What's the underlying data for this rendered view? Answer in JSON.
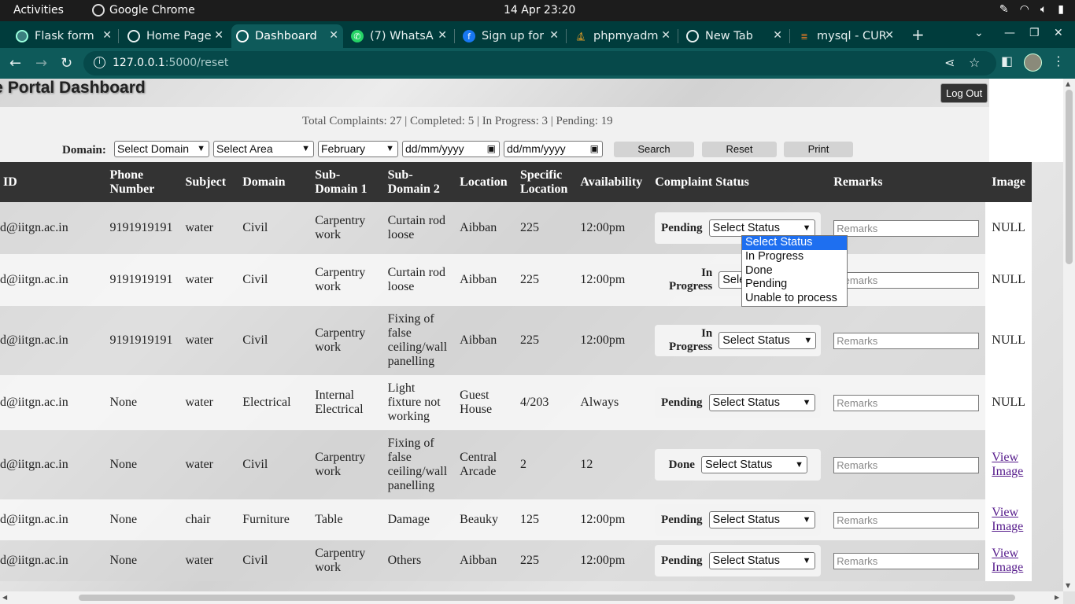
{
  "os": {
    "activities": "Activities",
    "app_name": "Google Chrome",
    "clock": "14 Apr  23:20"
  },
  "browser": {
    "tabs": [
      {
        "title": "Flask form",
        "icon": "flask-icon"
      },
      {
        "title": "Home Page",
        "icon": "globe-icon"
      },
      {
        "title": "Dashboard",
        "icon": "globe-icon",
        "active": true
      },
      {
        "title": "(7) WhatsA",
        "icon": "whatsapp-icon"
      },
      {
        "title": "Sign up for",
        "icon": "facebook-icon"
      },
      {
        "title": "phpmyadm",
        "icon": "phpmyadmin-icon"
      },
      {
        "title": "New Tab",
        "icon": "chrome-icon"
      },
      {
        "title": "mysql - CUR",
        "icon": "stackoverflow-icon"
      }
    ],
    "url_host": "127.0.0.1",
    "url_path": ":5000/reset"
  },
  "page": {
    "title": "ence Portal Dashboard",
    "logout_label": "Log Out",
    "stats": "Total Complaints: 27 | Completed: 5 | In Progress: 3 | Pending: 19"
  },
  "filters": {
    "domain_label": "Domain:",
    "domain_value": "Select Domain",
    "area_value": "Select Area",
    "month_value": "February",
    "date_from_placeholder": "dd/mm/yyyy",
    "date_to_placeholder": "dd/mm/yyyy",
    "search_label": "Search",
    "reset_label": "Reset",
    "print_label": "Print"
  },
  "table": {
    "headers": {
      "id": "ID",
      "phone": "Phone Number",
      "subject": "Subject",
      "domain": "Domain",
      "sub1": "Sub-Domain 1",
      "sub2": "Sub-Domain 2",
      "location": "Location",
      "specific": "Specific Location",
      "availability": "Availability",
      "status": "Complaint Status",
      "remarks": "Remarks",
      "image": "Image"
    },
    "status_select_value": "Select Status",
    "remarks_placeholder": "Remarks",
    "rows": [
      {
        "id": "d@iitgn.ac.in",
        "phone": "9191919191",
        "subject": "water",
        "domain": "Civil",
        "sub1": "Carpentry work",
        "sub2": "Curtain rod loose",
        "location": "Aibban",
        "specific": "225",
        "availability": "12:00pm",
        "status": "Pending",
        "image": "NULL"
      },
      {
        "id": "d@iitgn.ac.in",
        "phone": "9191919191",
        "subject": "water",
        "domain": "Civil",
        "sub1": "Carpentry work",
        "sub2": "Curtain rod loose",
        "location": "Aibban",
        "specific": "225",
        "availability": "12:00pm",
        "status": "In Progress",
        "image": "NULL"
      },
      {
        "id": "d@iitgn.ac.in",
        "phone": "9191919191",
        "subject": "water",
        "domain": "Civil",
        "sub1": "Carpentry work",
        "sub2": "Fixing of false ceiling/wall panelling",
        "location": "Aibban",
        "specific": "225",
        "availability": "12:00pm",
        "status": "In Progress",
        "image": "NULL"
      },
      {
        "id": "d@iitgn.ac.in",
        "phone": "None",
        "subject": "water",
        "domain": "Electrical",
        "sub1": "Internal Electrical",
        "sub2": "Light fixture not working",
        "location": "Guest House",
        "specific": "4/203",
        "availability": "Always",
        "status": "Pending",
        "image": "NULL"
      },
      {
        "id": "d@iitgn.ac.in",
        "phone": "None",
        "subject": "water",
        "domain": "Civil",
        "sub1": "Carpentry work",
        "sub2": "Fixing of false ceiling/wall panelling",
        "location": "Central Arcade",
        "specific": "2",
        "availability": "12",
        "status": "Done",
        "image": "View Image"
      },
      {
        "id": "d@iitgn.ac.in",
        "phone": "None",
        "subject": "chair",
        "domain": "Furniture",
        "sub1": "Table",
        "sub2": "Damage",
        "location": "Beauky",
        "specific": "125",
        "availability": "12:00pm",
        "status": "Pending",
        "image": "View Image"
      },
      {
        "id": "d@iitgn.ac.in",
        "phone": "None",
        "subject": "water",
        "domain": "Civil",
        "sub1": "Carpentry work",
        "sub2": "Others",
        "location": "Aibban",
        "specific": "225",
        "availability": "12:00pm",
        "status": "Pending",
        "image": "View Image"
      }
    ]
  },
  "status_dropdown": {
    "options": [
      "Select Status",
      "In Progress",
      "Done",
      "Pending",
      "Unable to process"
    ],
    "highlighted": "Select Status"
  }
}
